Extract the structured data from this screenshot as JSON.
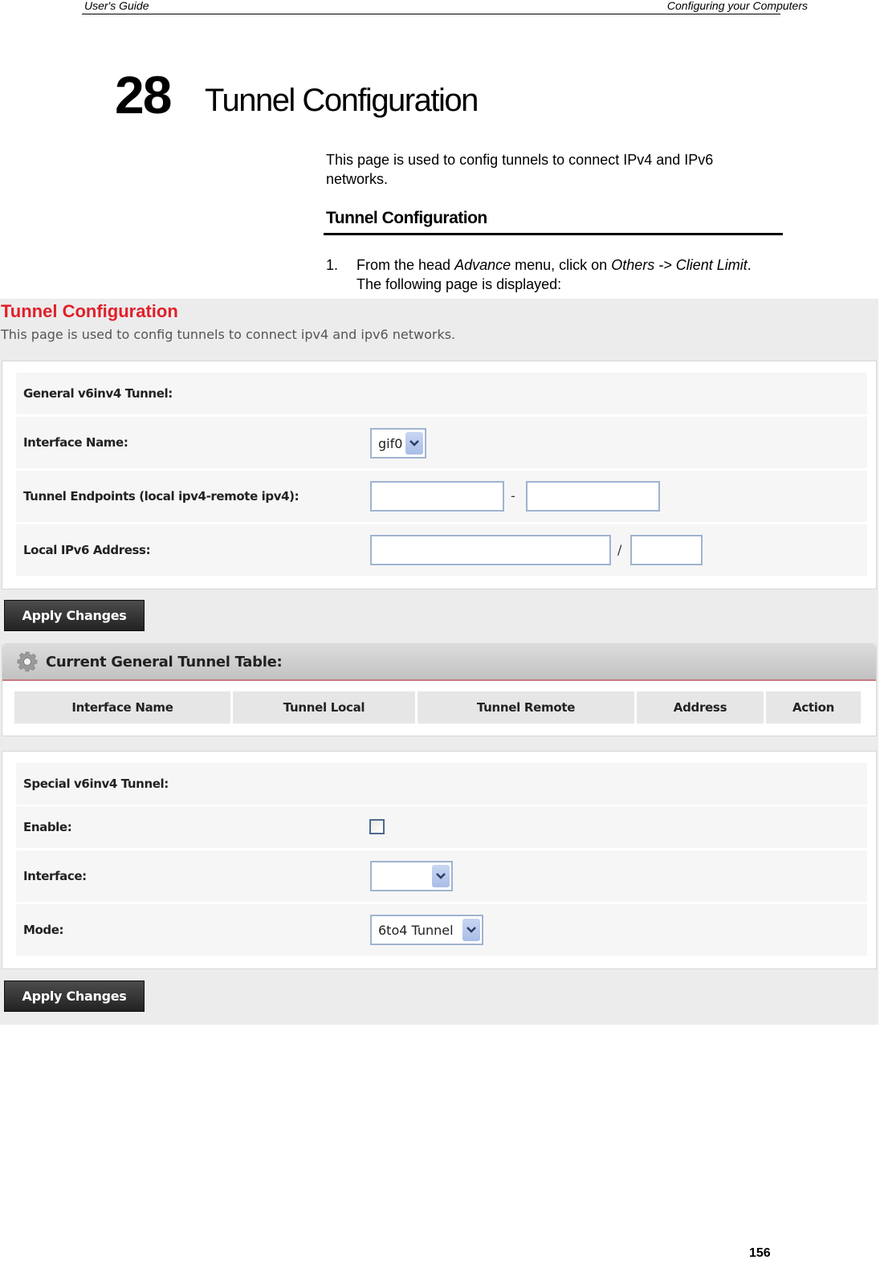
{
  "header": {
    "left": "User's Guide",
    "right": "Configuring your Computers"
  },
  "chapter": {
    "number": "28",
    "title": "Tunnel Configuration"
  },
  "intro": "This page is used to config tunnels to connect IPv4 and IPv6 networks.",
  "section_heading": "Tunnel Configuration",
  "step": {
    "number": "1.",
    "text_1": "From the head ",
    "em_1": "Advance",
    "text_2": " menu, click on ",
    "em_2": "Others -> Client Limit",
    "text_3": ". The following page is displayed:"
  },
  "screenshot": {
    "title": "Tunnel Configuration",
    "description": "This page is used to config tunnels to connect ipv4 and ipv6 networks.",
    "general": {
      "heading": "General v6inv4 Tunnel:",
      "interface_name_label": "Interface Name:",
      "interface_name_value": "gif0",
      "endpoints_label": "Tunnel Endpoints (local ipv4-remote ipv4):",
      "endpoints_separator": "-",
      "local_ipv4": "",
      "remote_ipv4": "",
      "ipv6_label": "Local IPv6 Address:",
      "ipv6_separator": "/",
      "ipv6_address": "",
      "ipv6_prefix": ""
    },
    "apply_label": "Apply Changes",
    "table": {
      "title": "Current General Tunnel Table:",
      "columns": [
        "Interface Name",
        "Tunnel Local",
        "Tunnel Remote",
        "Address",
        "Action"
      ],
      "rows": []
    },
    "special": {
      "heading": "Special v6inv4 Tunnel:",
      "enable_label": "Enable:",
      "enable_checked": false,
      "interface_label": "Interface:",
      "interface_value": "",
      "mode_label": "Mode:",
      "mode_value": "6to4 Tunnel"
    },
    "colors": {
      "title_red": "#e0202a",
      "button_dark": "#2b2b2b",
      "table_accent": "#c87a80"
    }
  },
  "page_number": "156"
}
